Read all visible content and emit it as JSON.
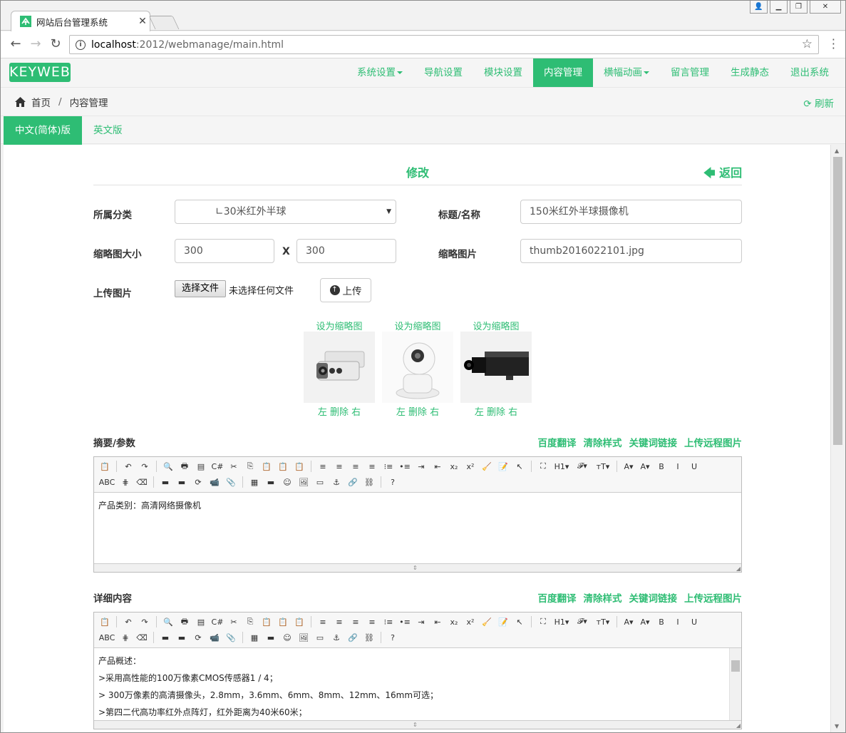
{
  "browser": {
    "tab_title": "网站后台管理系统",
    "url_host": "localhost",
    "url_path": ":2012/webmanage/main.html"
  },
  "app": {
    "logo": "KEYWEB",
    "menu": [
      "系统设置",
      "导航设置",
      "模块设置",
      "内容管理",
      "横幅动画",
      "留言管理",
      "生成静态",
      "退出系统"
    ],
    "active_menu": "内容管理",
    "colors": {
      "accent": "#2ebd74"
    }
  },
  "breadcrumb": {
    "home": "首页",
    "current": "内容管理",
    "refresh": "刷新"
  },
  "lang_tabs": {
    "zh": "中文(简体)版",
    "en": "英文版"
  },
  "form": {
    "heading": "修改",
    "back": "返回",
    "category_label": "所属分类",
    "category_value": "∟30米红外半球",
    "title_label": "标题/名称",
    "title_value": "150米红外半球摄像机",
    "thumb_size_label": "缩略图大小",
    "thumb_w": "300",
    "thumb_x": "X",
    "thumb_h": "300",
    "thumb_image_label": "缩略图片",
    "thumb_image_value": "thumb2016022101.jpg",
    "upload_label": "上传图片",
    "choose_file": "选择文件",
    "no_file": "未选择任何文件",
    "upload_btn": "上传"
  },
  "images": [
    {
      "set_thumb": "设为缩略图",
      "left": "左",
      "delete": "删除",
      "right": "右",
      "icon": "bullet-camera"
    },
    {
      "set_thumb": "设为缩略图",
      "left": "左",
      "delete": "删除",
      "right": "右",
      "icon": "dome-camera"
    },
    {
      "set_thumb": "设为缩略图",
      "left": "左",
      "delete": "删除",
      "right": "右",
      "icon": "box-camera"
    }
  ],
  "summary": {
    "label": "摘要/参数",
    "actions": [
      "百度翻译",
      "清除样式",
      "关键词链接",
      "上传远程图片"
    ],
    "content": "产品类别：高清网络摄像机"
  },
  "detail": {
    "label": "详细内容",
    "actions": [
      "百度翻译",
      "清除样式",
      "关键词链接",
      "上传远程图片"
    ],
    "lines": [
      "产品概述：",
      ">采用高性能的100万像素CMOS传感器1 / 4；",
      "> 300万像素的高清摄像头，2.8mm，3.6mm、6mm、8mm、12mm、16mm可选；",
      ">第四二代高功率红外点阵灯，红外距离为40米60米；"
    ]
  },
  "toolbar_rows": {
    "row1": [
      "📋",
      "|",
      "↶",
      "↷",
      "|",
      "🔍",
      "🖶",
      "▤",
      "C#",
      "✂",
      "⎘",
      "📋",
      "📋",
      "📋",
      "|",
      "≡",
      "≡",
      "≡",
      "≡",
      "⁝≡",
      "•≡",
      "⇥",
      "⇤",
      "x₂",
      "x²",
      "🧹",
      "📝",
      "↖",
      "|",
      "⛶",
      "H1▾",
      "𝓕▾",
      "ᴛT▾",
      "|",
      "A▾",
      "A▾",
      "B",
      "I",
      "U"
    ],
    "row2": [
      "ABC",
      "⋕",
      "⌫",
      "|",
      "▬",
      "▬",
      "⟳",
      "📹",
      "📎",
      "|",
      "▦",
      "▬",
      "☺",
      "🖼",
      "▭",
      "⚓",
      "🔗",
      "⛓",
      "|",
      "?"
    ]
  }
}
